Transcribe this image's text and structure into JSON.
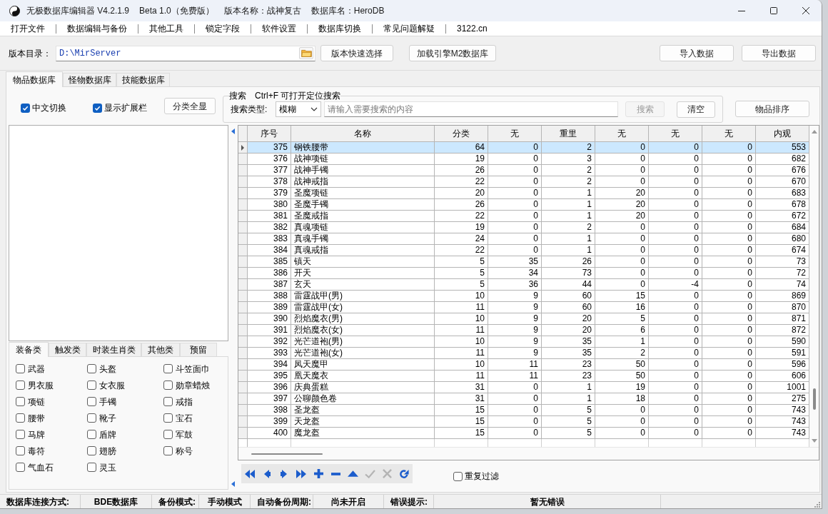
{
  "window": {
    "title": "无极数据库编辑器 V4.2.1.9",
    "edition": "Beta 1.0（免费版）",
    "version_name": "版本名称：战神复古",
    "database_name": "数据库名：HeroDB"
  },
  "menu": [
    "打开文件",
    "数据编辑与备份",
    "其他工具",
    "锁定字段",
    "软件设置",
    "数据库切换",
    "常见问题解疑",
    "3122.cn"
  ],
  "toolbar": {
    "directory_label": "版本目录：",
    "directory_value": "D:\\MirServer",
    "left_buttons": [
      "版本快速选择",
      "加载引擎M2数据库"
    ],
    "right_buttons": [
      "导入数据",
      "导出数据"
    ]
  },
  "tabs": [
    {
      "label": "物品数据库",
      "selected": true
    },
    {
      "label": "怪物数据库",
      "selected": false
    },
    {
      "label": "技能数据库",
      "selected": false
    }
  ],
  "options": [
    {
      "label": "中文切换",
      "checked": true
    },
    {
      "label": "显示扩展栏",
      "checked": true
    }
  ],
  "show_all_button": "分类全显",
  "search": {
    "title": "搜索",
    "hint": "Ctrl+F 可打开定位搜索",
    "type_label": "搜索类型:",
    "type_value": "模糊",
    "placeholder": "请输入需要搜索的内容",
    "search_button": {
      "label": "搜索",
      "disabled": true
    },
    "clear_button": "清空"
  },
  "sort_button": "物品排序",
  "category_tabs": [
    {
      "label": "装备类",
      "selected": true
    },
    {
      "label": "触发类",
      "selected": false
    },
    {
      "label": "时装生肖类",
      "selected": false
    },
    {
      "label": "其他类",
      "selected": false
    },
    {
      "label": "预留",
      "selected": false
    }
  ],
  "categories": [
    {
      "label": "武器",
      "checked": false
    },
    {
      "label": "头盔",
      "checked": false
    },
    {
      "label": "斗笠面巾",
      "checked": false
    },
    {
      "label": "男衣服",
      "checked": false
    },
    {
      "label": "女衣服",
      "checked": false
    },
    {
      "label": "勋章蜡烛",
      "checked": false
    },
    {
      "label": "项链",
      "checked": false
    },
    {
      "label": "手镯",
      "checked": false
    },
    {
      "label": "戒指",
      "checked": false
    },
    {
      "label": "腰带",
      "checked": false
    },
    {
      "label": "靴子",
      "checked": false
    },
    {
      "label": "宝石",
      "checked": false
    },
    {
      "label": "马牌",
      "checked": false
    },
    {
      "label": "盾牌",
      "checked": false
    },
    {
      "label": "军鼓",
      "checked": false
    },
    {
      "label": "毒符",
      "checked": false
    },
    {
      "label": "翅膀",
      "checked": false
    },
    {
      "label": "称号",
      "checked": false
    },
    {
      "label": "气血石",
      "checked": false
    },
    {
      "label": "灵玉",
      "checked": false
    }
  ],
  "table": {
    "columns": [
      "序号",
      "名称",
      "分类",
      "无",
      "重里",
      "无",
      "无",
      "无",
      "内观"
    ],
    "rows": [
      {
        "selected": true,
        "cells": [
          "375",
          "钢铁腰带",
          "64",
          "0",
          "2",
          "0",
          "0",
          "0",
          "553"
        ]
      },
      {
        "selected": false,
        "cells": [
          "376",
          "战神项链",
          "19",
          "0",
          "3",
          "0",
          "0",
          "0",
          "682"
        ]
      },
      {
        "selected": false,
        "cells": [
          "377",
          "战神手镯",
          "26",
          "0",
          "2",
          "0",
          "0",
          "0",
          "676"
        ]
      },
      {
        "selected": false,
        "cells": [
          "378",
          "战神戒指",
          "22",
          "0",
          "2",
          "0",
          "0",
          "0",
          "670"
        ]
      },
      {
        "selected": false,
        "cells": [
          "379",
          "圣魔项链",
          "20",
          "0",
          "1",
          "20",
          "0",
          "0",
          "683"
        ]
      },
      {
        "selected": false,
        "cells": [
          "380",
          "圣魔手镯",
          "26",
          "0",
          "1",
          "20",
          "0",
          "0",
          "678"
        ]
      },
      {
        "selected": false,
        "cells": [
          "381",
          "圣魔戒指",
          "22",
          "0",
          "1",
          "20",
          "0",
          "0",
          "672"
        ]
      },
      {
        "selected": false,
        "cells": [
          "382",
          "真魂项链",
          "19",
          "0",
          "2",
          "0",
          "0",
          "0",
          "684"
        ]
      },
      {
        "selected": false,
        "cells": [
          "383",
          "真魂手镯",
          "24",
          "0",
          "1",
          "0",
          "0",
          "0",
          "680"
        ]
      },
      {
        "selected": false,
        "cells": [
          "384",
          "真魂戒指",
          "22",
          "0",
          "1",
          "0",
          "0",
          "0",
          "674"
        ]
      },
      {
        "selected": false,
        "cells": [
          "385",
          "镇天",
          "5",
          "35",
          "26",
          "0",
          "0",
          "0",
          "73"
        ]
      },
      {
        "selected": false,
        "cells": [
          "386",
          "开天",
          "5",
          "34",
          "73",
          "0",
          "0",
          "0",
          "72"
        ]
      },
      {
        "selected": false,
        "cells": [
          "387",
          "玄天",
          "5",
          "36",
          "44",
          "0",
          "-4",
          "0",
          "74"
        ]
      },
      {
        "selected": false,
        "cells": [
          "388",
          "雷霆战甲(男)",
          "10",
          "9",
          "60",
          "15",
          "0",
          "0",
          "869"
        ]
      },
      {
        "selected": false,
        "cells": [
          "389",
          "雷霆战甲(女)",
          "11",
          "9",
          "60",
          "16",
          "0",
          "0",
          "870"
        ]
      },
      {
        "selected": false,
        "cells": [
          "390",
          "烈焰魔衣(男)",
          "10",
          "9",
          "20",
          "5",
          "0",
          "0",
          "871"
        ]
      },
      {
        "selected": false,
        "cells": [
          "391",
          "烈焰魔衣(女)",
          "11",
          "9",
          "20",
          "6",
          "0",
          "0",
          "872"
        ]
      },
      {
        "selected": false,
        "cells": [
          "392",
          "光芒道袍(男)",
          "10",
          "9",
          "35",
          "1",
          "0",
          "0",
          "590"
        ]
      },
      {
        "selected": false,
        "cells": [
          "393",
          "光芒道袍(女)",
          "11",
          "9",
          "35",
          "2",
          "0",
          "0",
          "591"
        ]
      },
      {
        "selected": false,
        "cells": [
          "394",
          "凤天魔甲",
          "10",
          "11",
          "23",
          "50",
          "0",
          "0",
          "596"
        ]
      },
      {
        "selected": false,
        "cells": [
          "395",
          "凰天魔衣",
          "11",
          "11",
          "23",
          "50",
          "0",
          "0",
          "606"
        ]
      },
      {
        "selected": false,
        "cells": [
          "396",
          "庆典蛋糕",
          "31",
          "0",
          "1",
          "19",
          "0",
          "0",
          "1001"
        ]
      },
      {
        "selected": false,
        "cells": [
          "397",
          "公聊颜色卷",
          "31",
          "0",
          "1",
          "18",
          "0",
          "0",
          "275"
        ]
      },
      {
        "selected": false,
        "cells": [
          "398",
          "圣龙盔",
          "15",
          "0",
          "5",
          "0",
          "0",
          "0",
          "743"
        ]
      },
      {
        "selected": false,
        "cells": [
          "399",
          "天龙盔",
          "15",
          "0",
          "5",
          "0",
          "0",
          "0",
          "743"
        ]
      },
      {
        "selected": false,
        "cells": [
          "400",
          "魔龙盔",
          "15",
          "0",
          "5",
          "0",
          "0",
          "0",
          "743"
        ]
      }
    ]
  },
  "navigator": {
    "buttons": [
      {
        "kind": "first",
        "disabled": false
      },
      {
        "kind": "prior",
        "disabled": false
      },
      {
        "kind": "next",
        "disabled": false
      },
      {
        "kind": "last",
        "disabled": false
      },
      {
        "kind": "insert",
        "disabled": false
      },
      {
        "kind": "delete",
        "disabled": false
      },
      {
        "kind": "edit",
        "disabled": false
      },
      {
        "kind": "post",
        "disabled": true
      },
      {
        "kind": "cancel",
        "disabled": true
      },
      {
        "kind": "refresh",
        "disabled": false
      }
    ]
  },
  "duplicate_filter": {
    "label": "重复过滤",
    "checked": false
  },
  "status_bar": [
    {
      "label": "数据库连接方式:",
      "value": "BDE数据库"
    },
    {
      "label": "备份模式:",
      "value": "手动模式"
    },
    {
      "label": "自动备份周期:",
      "value": "尚未开启"
    },
    {
      "label": "错误提示:",
      "value": "暂无错误"
    }
  ]
}
